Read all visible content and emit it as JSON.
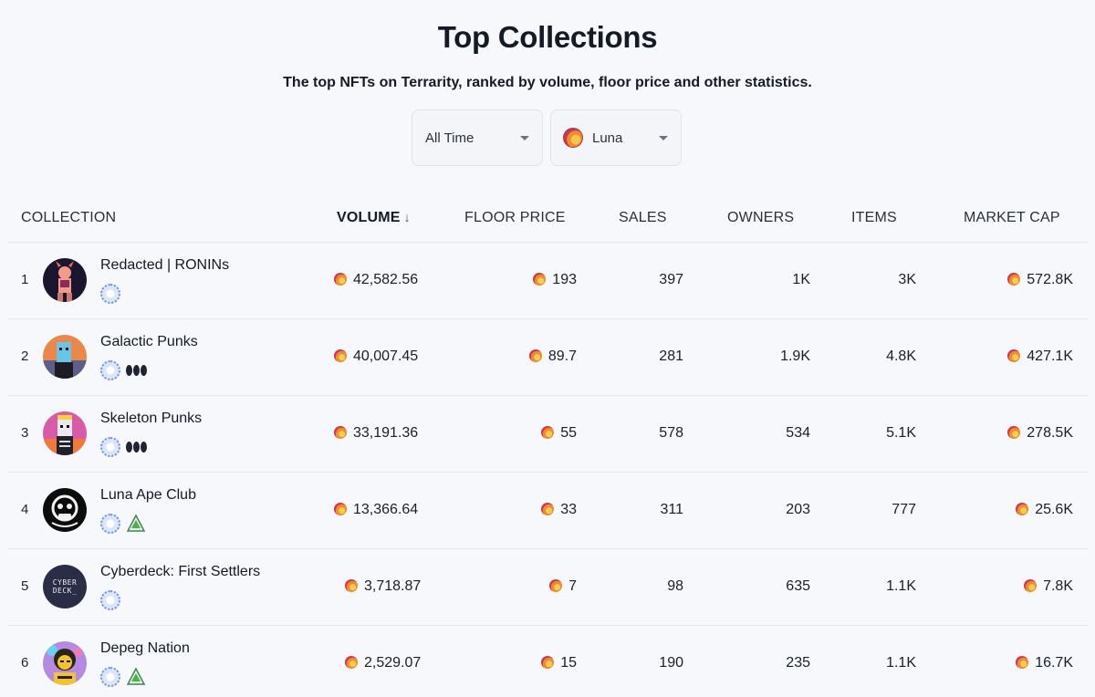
{
  "header": {
    "title": "Top Collections",
    "subtitle": "The top NFTs on Terrarity, ranked by volume, floor price and other statistics."
  },
  "filters": {
    "time": "All Time",
    "token": "Luna"
  },
  "table": {
    "columns": {
      "collection": "COLLECTION",
      "volume": "VOLUME",
      "floor_price": "FLOOR PRICE",
      "sales": "SALES",
      "owners": "OWNERS",
      "items": "ITEMS",
      "market_cap": "MARKET CAP"
    },
    "sort_icon": "arrow-down-icon",
    "rows": [
      {
        "rank": "1",
        "name": "Redacted | RONINs",
        "badges": [
          "sun-badge"
        ],
        "volume": "42,582.56",
        "floor": "193",
        "sales": "397",
        "owners": "1K",
        "items": "3K",
        "cap": "572.8K"
      },
      {
        "rank": "2",
        "name": "Galactic Punks",
        "badges": [
          "sun-badge",
          "dots-badge"
        ],
        "volume": "40,007.45",
        "floor": "89.7",
        "sales": "281",
        "owners": "1.9K",
        "items": "4.8K",
        "cap": "427.1K"
      },
      {
        "rank": "3",
        "name": "Skeleton Punks",
        "badges": [
          "sun-badge",
          "dots-badge"
        ],
        "volume": "33,191.36",
        "floor": "55",
        "sales": "578",
        "owners": "534",
        "items": "5.1K",
        "cap": "278.5K"
      },
      {
        "rank": "4",
        "name": "Luna Ape Club",
        "badges": [
          "sun-badge",
          "triangle-badge"
        ],
        "volume": "13,366.64",
        "floor": "33",
        "sales": "311",
        "owners": "203",
        "items": "777",
        "cap": "25.6K"
      },
      {
        "rank": "5",
        "name": "Cyberdeck: First Settlers",
        "badges": [
          "sun-badge"
        ],
        "volume": "3,718.87",
        "floor": "7",
        "sales": "98",
        "owners": "635",
        "items": "1.1K",
        "cap": "7.8K"
      },
      {
        "rank": "6",
        "name": "Depeg Nation",
        "badges": [
          "sun-badge",
          "triangle-badge"
        ],
        "volume": "2,529.07",
        "floor": "15",
        "sales": "190",
        "owners": "235",
        "items": "1.1K",
        "cap": "16.7K"
      }
    ]
  },
  "avatar_text": {
    "cyberdeck": "CYBER DECK_"
  },
  "colors": {
    "background": "#f6f8fb",
    "text": "#141a26",
    "divider": "#e3e6eb"
  }
}
